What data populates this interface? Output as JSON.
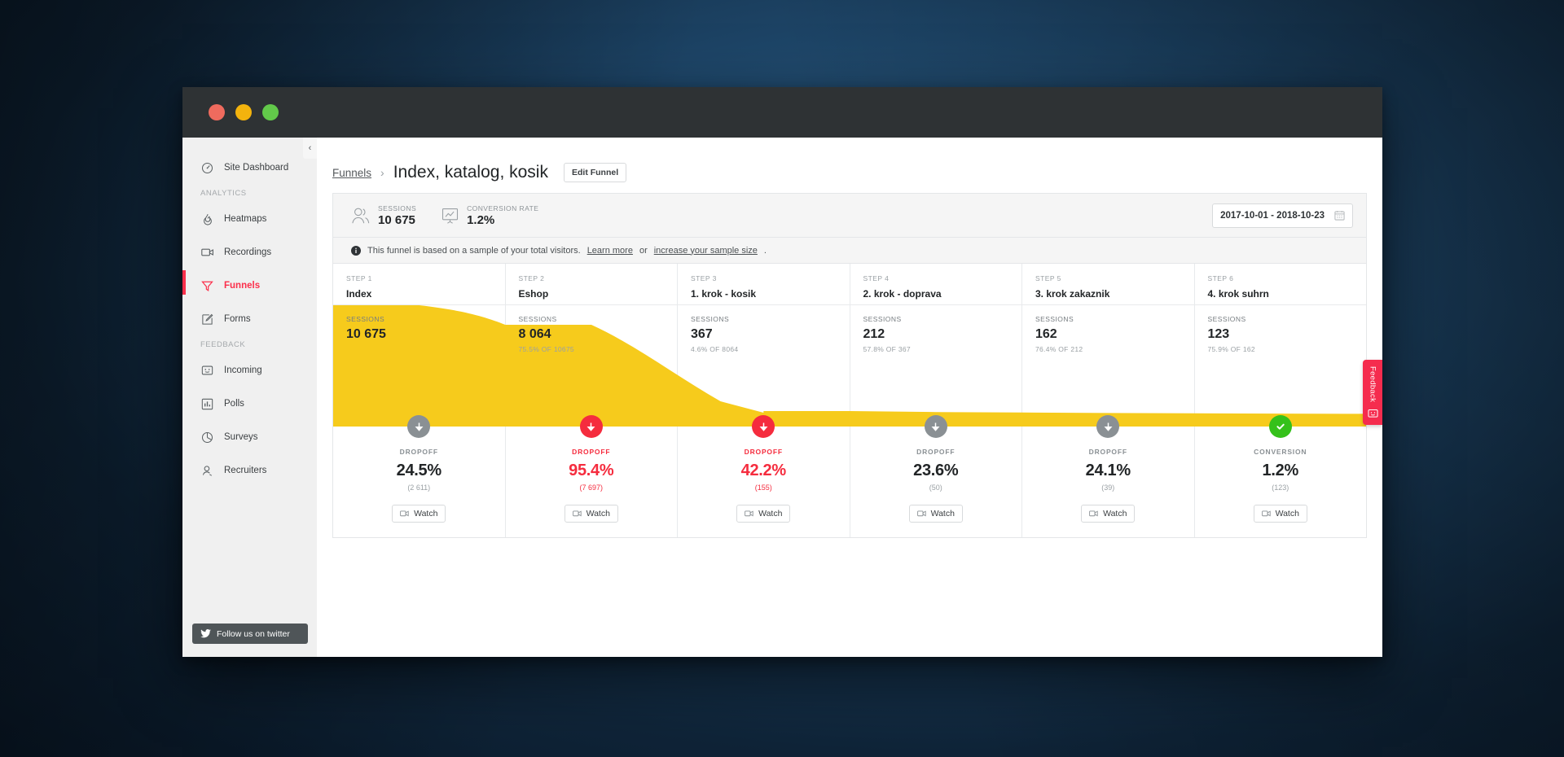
{
  "window": {
    "traffic_lights": [
      "close",
      "minimize",
      "maximize"
    ]
  },
  "sidebar": {
    "collapse_icon": "chevron-left-icon",
    "top_items": [
      {
        "label": "Site Dashboard",
        "icon": "dashboard-gauge-icon"
      }
    ],
    "sections": [
      {
        "title": "ANALYTICS",
        "items": [
          {
            "label": "Heatmaps",
            "icon": "flame-icon",
            "active": false
          },
          {
            "label": "Recordings",
            "icon": "video-camera-icon",
            "active": false
          },
          {
            "label": "Funnels",
            "icon": "funnel-icon",
            "active": true
          },
          {
            "label": "Forms",
            "icon": "form-pencil-icon",
            "active": false
          }
        ]
      },
      {
        "title": "FEEDBACK",
        "items": [
          {
            "label": "Incoming",
            "icon": "smiley-box-icon",
            "active": false
          },
          {
            "label": "Polls",
            "icon": "bar-chart-icon",
            "active": false
          },
          {
            "label": "Surveys",
            "icon": "pie-chart-icon",
            "active": false
          },
          {
            "label": "Recruiters",
            "icon": "user-search-icon",
            "active": false
          }
        ]
      }
    ],
    "twitter_button": {
      "label": "Follow us on twitter",
      "icon": "twitter-bird-icon"
    }
  },
  "header": {
    "breadcrumb_link": "Funnels",
    "breadcrumb_separator": "›",
    "title": "Index, katalog, kosik",
    "edit_button": "Edit Funnel"
  },
  "stats": {
    "sessions": {
      "label": "SESSIONS",
      "value": "10 675",
      "icon": "people-icon"
    },
    "conversion": {
      "label": "CONVERSION RATE",
      "value": "1.2%",
      "icon": "chart-board-icon"
    },
    "date_range": {
      "value": "2017-10-01 - 2018-10-23",
      "icon": "calendar-icon"
    }
  },
  "notice": {
    "icon": "info-icon",
    "text_before": "This funnel is based on a sample of your total visitors.",
    "link1": "Learn more",
    "text_middle": "or",
    "link2": "increase your sample size",
    "text_after": "."
  },
  "colors": {
    "accent_red": "#fb2f4b",
    "funnel_yellow": "#f6cb1c",
    "dropoff_red": "#f52c3e",
    "marker_grey": "#8a9094",
    "conversion_green": "#35c11b"
  },
  "feedback_tab": {
    "label": "Feedback",
    "icon": "smiley-box-icon"
  },
  "watch_label": "Watch",
  "chart_data": {
    "type": "area",
    "title": "Funnel: Index, katalog, kosik",
    "categories": [
      "Index",
      "Eshop",
      "1. krok - kosik",
      "2. krok - doprava",
      "3. krok zakaznik",
      "4. krok suhrn"
    ],
    "values": [
      10675,
      8064,
      367,
      212,
      162,
      123
    ],
    "xlabel": "",
    "ylabel": "Sessions",
    "ylim": [
      0,
      10675
    ],
    "grid": false,
    "legend": "none",
    "series": [
      {
        "name": "Sessions",
        "values": [
          10675,
          8064,
          367,
          212,
          162,
          123
        ]
      }
    ]
  },
  "funnel": {
    "step_label_prefix": "STEP",
    "sessions_label": "SESSIONS",
    "dropoff_label": "DROPOFF",
    "conversion_label": "CONVERSION",
    "steps": [
      {
        "step": "STEP 1",
        "name": "Index",
        "sessions": "10 675",
        "sessions_sub": "",
        "metric_label": "DROPOFF",
        "metric_value": "24.5%",
        "metric_count": "(2 611)",
        "metric_state": "grey",
        "marker": "arrow-down-icon",
        "watch": "Watch"
      },
      {
        "step": "STEP 2",
        "name": "Eshop",
        "sessions": "8 064",
        "sessions_sub": "75.5% OF 10675",
        "metric_label": "DROPOFF",
        "metric_value": "95.4%",
        "metric_count": "(7 697)",
        "metric_state": "red",
        "marker": "arrow-down-icon",
        "watch": "Watch"
      },
      {
        "step": "STEP 3",
        "name": "1. krok - kosik",
        "sessions": "367",
        "sessions_sub": "4.6% OF 8064",
        "metric_label": "DROPOFF",
        "metric_value": "42.2%",
        "metric_count": "(155)",
        "metric_state": "red",
        "marker": "arrow-down-icon",
        "watch": "Watch"
      },
      {
        "step": "STEP 4",
        "name": "2. krok - doprava",
        "sessions": "212",
        "sessions_sub": "57.8% OF 367",
        "metric_label": "DROPOFF",
        "metric_value": "23.6%",
        "metric_count": "(50)",
        "metric_state": "grey",
        "marker": "arrow-down-icon",
        "watch": "Watch"
      },
      {
        "step": "STEP 5",
        "name": "3. krok zakaznik",
        "sessions": "162",
        "sessions_sub": "76.4% OF 212",
        "metric_label": "DROPOFF",
        "metric_value": "24.1%",
        "metric_count": "(39)",
        "metric_state": "grey",
        "marker": "arrow-down-icon",
        "watch": "Watch"
      },
      {
        "step": "STEP 6",
        "name": "4. krok suhrn",
        "sessions": "123",
        "sessions_sub": "75.9% OF 162",
        "metric_label": "CONVERSION",
        "metric_value": "1.2%",
        "metric_count": "(123)",
        "metric_state": "green",
        "marker": "check-icon",
        "watch": "Watch"
      }
    ]
  }
}
